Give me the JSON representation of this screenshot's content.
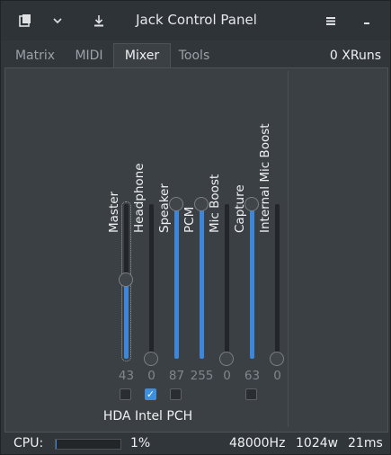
{
  "title": "Jack Control Panel",
  "tabs": [
    {
      "label": "Matrix"
    },
    {
      "label": "MIDI"
    },
    {
      "label": "Mixer"
    },
    {
      "label": "Tools"
    }
  ],
  "xruns": "0 XRuns",
  "mixer": {
    "card_name": "HDA Intel PCH",
    "channels": [
      {
        "name": "Master",
        "value": "43",
        "level": 0.51,
        "mute": false,
        "has_checkbox": true
      },
      {
        "name": "Headphone",
        "value": "0",
        "level": 0.0,
        "mute": true,
        "has_checkbox": true
      },
      {
        "name": "Speaker",
        "value": "87",
        "level": 1.0,
        "mute": false,
        "has_checkbox": true
      },
      {
        "name": "PCM",
        "value": "255",
        "level": 1.0,
        "mute": false,
        "has_checkbox": false
      },
      {
        "name": "Mic Boost",
        "value": "0",
        "level": 0.0,
        "mute": false,
        "has_checkbox": false
      },
      {
        "name": "Capture",
        "value": "63",
        "level": 1.0,
        "mute": false,
        "has_checkbox": true
      },
      {
        "name": "Internal Mic Boost",
        "value": "0",
        "level": 0.0,
        "mute": false,
        "has_checkbox": false
      }
    ]
  },
  "status": {
    "cpu_label": "CPU:",
    "cpu_percent": "1%",
    "cpu_fraction": 0.01,
    "sample_rate": "48000Hz",
    "buffer": "1024w",
    "latency": "21ms"
  },
  "colors": {
    "accent": "#3d86d9",
    "background": "#31363b"
  }
}
